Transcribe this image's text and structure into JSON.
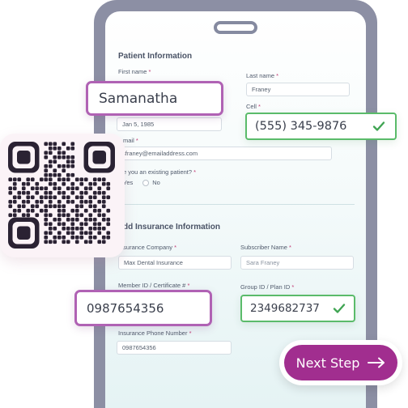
{
  "form": {
    "patient_section_title": "Patient Information",
    "first_name_label": "First name",
    "last_name_label": "Last name",
    "last_name_value": "Franey",
    "cell_label": "Cell",
    "dob_value": "Jan 5, 1985",
    "email_label": "mail",
    "email_value": "sfraney@emailaddress.com",
    "existing_patient_label": "e you an existing patient?",
    "yes_label": "Yes",
    "no_label": "No",
    "insurance_section_title": "dd Insurance Information",
    "insurance_company_label": "nsurance Company",
    "insurance_company_value": "Max Dental Insurance",
    "subscriber_name_label": "Subscriber Name",
    "subscriber_name_value": "Sara Franey",
    "member_id_label": "Member ID / Certificate #",
    "group_id_label": "Group ID / Plan ID",
    "insurance_phone_label": "Insurance Phone Number",
    "insurance_phone_value": "0987654356",
    "required_marker": "*"
  },
  "callouts": {
    "first_name": "Samanatha",
    "cell": "(555) 345-9876",
    "member_id": "0987654356",
    "group_id": "2349682737"
  },
  "next_button": {
    "label": "Next Step"
  },
  "colors": {
    "accent_purple": "#a12e8f",
    "valid_green": "#5abb6a",
    "required_pink": "#c13a73",
    "qr_dark": "#2a2233"
  },
  "icons": [
    "check-icon",
    "arrow-right-icon",
    "qr-code-icon"
  ]
}
